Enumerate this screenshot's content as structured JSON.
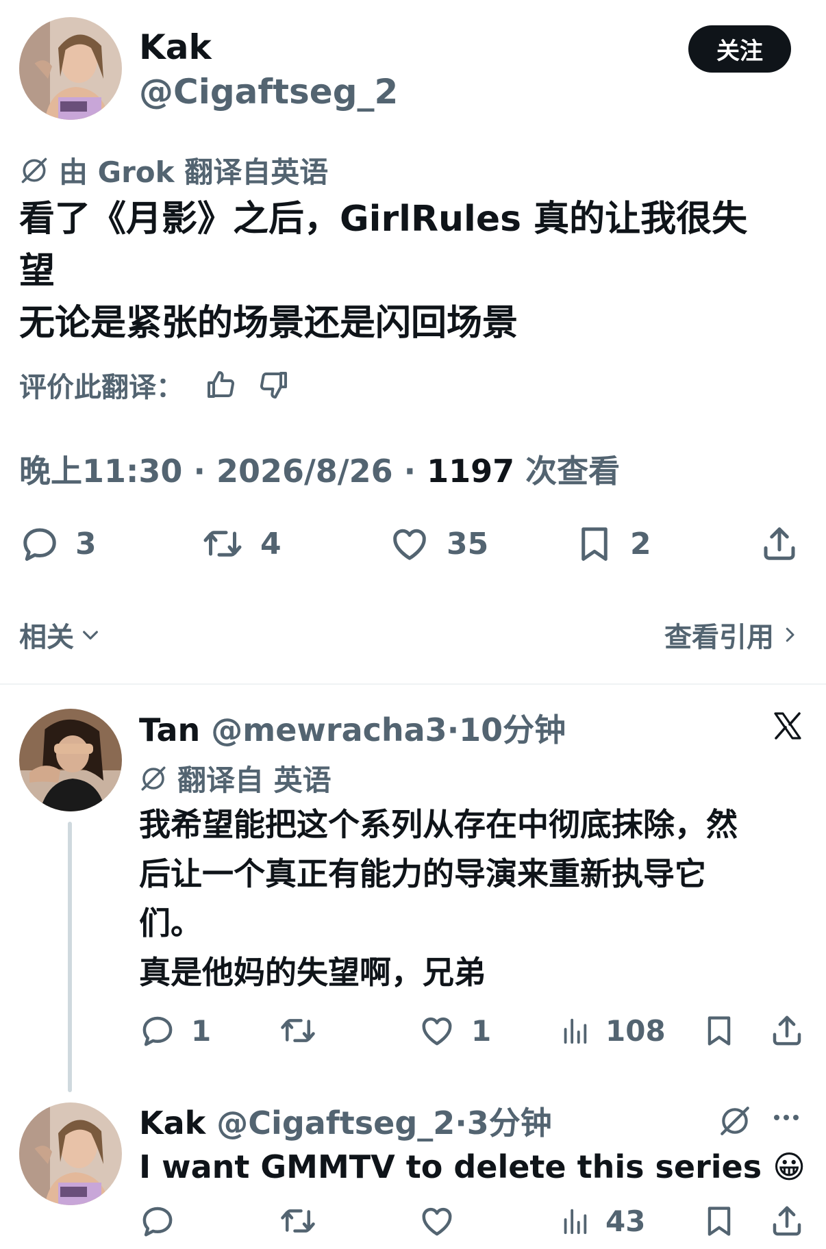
{
  "main_tweet": {
    "author_name": "Kak",
    "author_handle": "@Cigaftseg_2",
    "follow_label": "关注",
    "translation_note": "由 Grok 翻译自英语",
    "text_line1": "看了《月影》之后，GirlRules 真的让我很失",
    "text_line2": "望",
    "text_line3": "无论是紧张的场景还是闪回场景",
    "rate_label": "评价此翻译：",
    "time": "晚上11:30",
    "date": "2026/8/26",
    "views_count": "1197",
    "views_label": "次查看",
    "replies": "3",
    "retweets": "4",
    "likes": "35",
    "bookmarks": "2",
    "related_label": "相关",
    "view_quotes_label": "查看引用"
  },
  "reply_1": {
    "author_name": "Tan",
    "author_handle": "@mewracha3",
    "time": "10分钟",
    "translation_note": "翻译自 英语",
    "text_line1": "我希望能把这个系列从存在中彻底抹除，然",
    "text_line2": "后让一个真正有能力的导演来重新执导它",
    "text_line3": "们。",
    "text_line4": "真是他妈的失望啊，兄弟",
    "replies": "1",
    "likes": "1",
    "views": "108"
  },
  "reply_2": {
    "author_name": "Kak",
    "author_handle": "@Cigaftseg_2",
    "time": "3分钟",
    "text": "I want GMMTV to delete this series 😀",
    "views": "43"
  },
  "separator_dot": "·",
  "colors": {
    "text_primary": "#0f1419",
    "text_muted": "#536471",
    "follow_bg": "#0f1419",
    "divider": "#eff3f4",
    "thread_line": "#cfd9de"
  },
  "icons": [
    "translate-icon",
    "thumbs-up-icon",
    "thumbs-down-icon",
    "reply-icon",
    "retweet-icon",
    "like-icon",
    "bookmark-icon",
    "share-icon",
    "views-icon",
    "x-logo-icon",
    "more-icon",
    "chevron-down-icon",
    "chevron-right-icon"
  ]
}
